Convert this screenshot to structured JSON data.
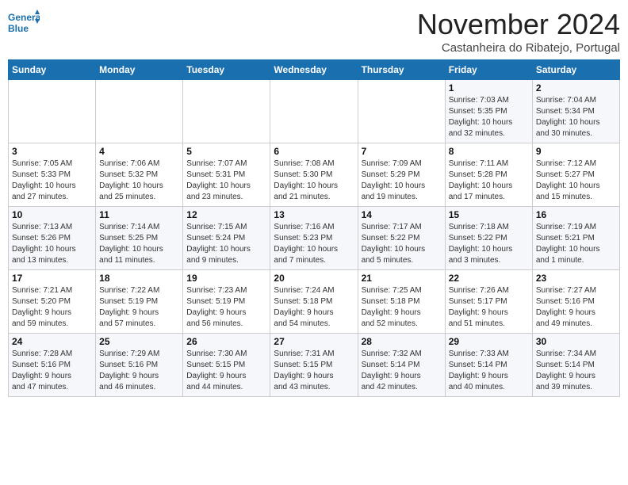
{
  "header": {
    "logo_line1": "General",
    "logo_line2": "Blue",
    "month": "November 2024",
    "location": "Castanheira do Ribatejo, Portugal"
  },
  "weekdays": [
    "Sunday",
    "Monday",
    "Tuesday",
    "Wednesday",
    "Thursday",
    "Friday",
    "Saturday"
  ],
  "weeks": [
    [
      {
        "day": "",
        "info": ""
      },
      {
        "day": "",
        "info": ""
      },
      {
        "day": "",
        "info": ""
      },
      {
        "day": "",
        "info": ""
      },
      {
        "day": "",
        "info": ""
      },
      {
        "day": "1",
        "info": "Sunrise: 7:03 AM\nSunset: 5:35 PM\nDaylight: 10 hours\nand 32 minutes."
      },
      {
        "day": "2",
        "info": "Sunrise: 7:04 AM\nSunset: 5:34 PM\nDaylight: 10 hours\nand 30 minutes."
      }
    ],
    [
      {
        "day": "3",
        "info": "Sunrise: 7:05 AM\nSunset: 5:33 PM\nDaylight: 10 hours\nand 27 minutes."
      },
      {
        "day": "4",
        "info": "Sunrise: 7:06 AM\nSunset: 5:32 PM\nDaylight: 10 hours\nand 25 minutes."
      },
      {
        "day": "5",
        "info": "Sunrise: 7:07 AM\nSunset: 5:31 PM\nDaylight: 10 hours\nand 23 minutes."
      },
      {
        "day": "6",
        "info": "Sunrise: 7:08 AM\nSunset: 5:30 PM\nDaylight: 10 hours\nand 21 minutes."
      },
      {
        "day": "7",
        "info": "Sunrise: 7:09 AM\nSunset: 5:29 PM\nDaylight: 10 hours\nand 19 minutes."
      },
      {
        "day": "8",
        "info": "Sunrise: 7:11 AM\nSunset: 5:28 PM\nDaylight: 10 hours\nand 17 minutes."
      },
      {
        "day": "9",
        "info": "Sunrise: 7:12 AM\nSunset: 5:27 PM\nDaylight: 10 hours\nand 15 minutes."
      }
    ],
    [
      {
        "day": "10",
        "info": "Sunrise: 7:13 AM\nSunset: 5:26 PM\nDaylight: 10 hours\nand 13 minutes."
      },
      {
        "day": "11",
        "info": "Sunrise: 7:14 AM\nSunset: 5:25 PM\nDaylight: 10 hours\nand 11 minutes."
      },
      {
        "day": "12",
        "info": "Sunrise: 7:15 AM\nSunset: 5:24 PM\nDaylight: 10 hours\nand 9 minutes."
      },
      {
        "day": "13",
        "info": "Sunrise: 7:16 AM\nSunset: 5:23 PM\nDaylight: 10 hours\nand 7 minutes."
      },
      {
        "day": "14",
        "info": "Sunrise: 7:17 AM\nSunset: 5:22 PM\nDaylight: 10 hours\nand 5 minutes."
      },
      {
        "day": "15",
        "info": "Sunrise: 7:18 AM\nSunset: 5:22 PM\nDaylight: 10 hours\nand 3 minutes."
      },
      {
        "day": "16",
        "info": "Sunrise: 7:19 AM\nSunset: 5:21 PM\nDaylight: 10 hours\nand 1 minute."
      }
    ],
    [
      {
        "day": "17",
        "info": "Sunrise: 7:21 AM\nSunset: 5:20 PM\nDaylight: 9 hours\nand 59 minutes."
      },
      {
        "day": "18",
        "info": "Sunrise: 7:22 AM\nSunset: 5:19 PM\nDaylight: 9 hours\nand 57 minutes."
      },
      {
        "day": "19",
        "info": "Sunrise: 7:23 AM\nSunset: 5:19 PM\nDaylight: 9 hours\nand 56 minutes."
      },
      {
        "day": "20",
        "info": "Sunrise: 7:24 AM\nSunset: 5:18 PM\nDaylight: 9 hours\nand 54 minutes."
      },
      {
        "day": "21",
        "info": "Sunrise: 7:25 AM\nSunset: 5:18 PM\nDaylight: 9 hours\nand 52 minutes."
      },
      {
        "day": "22",
        "info": "Sunrise: 7:26 AM\nSunset: 5:17 PM\nDaylight: 9 hours\nand 51 minutes."
      },
      {
        "day": "23",
        "info": "Sunrise: 7:27 AM\nSunset: 5:16 PM\nDaylight: 9 hours\nand 49 minutes."
      }
    ],
    [
      {
        "day": "24",
        "info": "Sunrise: 7:28 AM\nSunset: 5:16 PM\nDaylight: 9 hours\nand 47 minutes."
      },
      {
        "day": "25",
        "info": "Sunrise: 7:29 AM\nSunset: 5:16 PM\nDaylight: 9 hours\nand 46 minutes."
      },
      {
        "day": "26",
        "info": "Sunrise: 7:30 AM\nSunset: 5:15 PM\nDaylight: 9 hours\nand 44 minutes."
      },
      {
        "day": "27",
        "info": "Sunrise: 7:31 AM\nSunset: 5:15 PM\nDaylight: 9 hours\nand 43 minutes."
      },
      {
        "day": "28",
        "info": "Sunrise: 7:32 AM\nSunset: 5:14 PM\nDaylight: 9 hours\nand 42 minutes."
      },
      {
        "day": "29",
        "info": "Sunrise: 7:33 AM\nSunset: 5:14 PM\nDaylight: 9 hours\nand 40 minutes."
      },
      {
        "day": "30",
        "info": "Sunrise: 7:34 AM\nSunset: 5:14 PM\nDaylight: 9 hours\nand 39 minutes."
      }
    ]
  ]
}
